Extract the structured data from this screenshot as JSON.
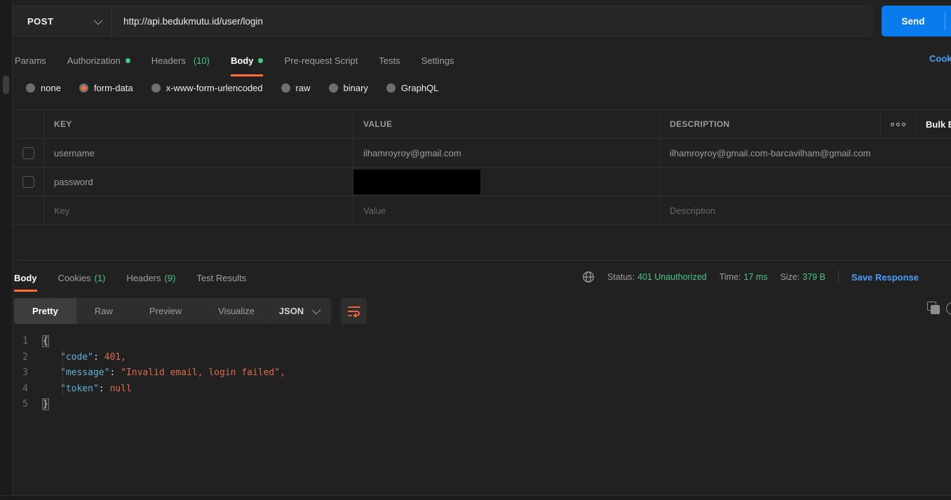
{
  "colors": {
    "accent_orange": "#ff6c37",
    "green": "#4ac885",
    "link_blue": "#4c9df8",
    "send_blue": "#097bed"
  },
  "request": {
    "method": "POST",
    "url": "http://api.bedukmutu.id/user/login",
    "send_label": "Send",
    "cookies_link": "Cookies",
    "tabs": {
      "params": "Params",
      "authorization": "Authorization",
      "headers": "Headers",
      "headers_count": "(10)",
      "body": "Body",
      "prerequest": "Pre-request Script",
      "tests": "Tests",
      "settings": "Settings"
    },
    "modes": {
      "none": "none",
      "form_data": "form-data",
      "urlencoded": "x-www-form-urlencoded",
      "raw": "raw",
      "binary": "binary",
      "graphql": "GraphQL"
    },
    "selected_mode": "form-data"
  },
  "form_table": {
    "col_key": "KEY",
    "col_value": "VALUE",
    "col_description": "DESCRIPTION",
    "bulk_edit": "Bulk Edit",
    "rows": [
      {
        "key": "username",
        "value": "ilhamroyroy@gmail.com",
        "description": "ilhamroyroy@gmail.com-barcavilham@gmail.com"
      },
      {
        "key": "password",
        "value": "",
        "description": ""
      }
    ],
    "placeholder": {
      "key": "Key",
      "value": "Value",
      "description": "Description"
    }
  },
  "response": {
    "tabs": {
      "body": "Body",
      "cookies": "Cookies",
      "cookies_count": "(1)",
      "headers": "Headers",
      "headers_count": "(9)",
      "test_results": "Test Results"
    },
    "meta": {
      "status_label": "Status:",
      "status_value": "401 Unauthorized",
      "time_label": "Time:",
      "time_value": "17 ms",
      "size_label": "Size:",
      "size_value": "379 B",
      "save_response": "Save Response"
    },
    "views": {
      "pretty": "Pretty",
      "raw": "Raw",
      "preview": "Preview",
      "visualize": "Visualize"
    },
    "format": "JSON",
    "code": {
      "line_numbers": [
        "1",
        "2",
        "3",
        "4",
        "5"
      ],
      "l1_open": "{",
      "l2_key": "\"code\"",
      "l2_colon": ": ",
      "l2_val": "401",
      "l2_comma": ",",
      "l3_key": "\"message\"",
      "l3_colon": ": ",
      "l3_val": "\"Invalid email, login failed\"",
      "l3_comma": ",",
      "l4_key": "\"token\"",
      "l4_colon": ": ",
      "l4_val": "null",
      "l5_close": "}"
    }
  }
}
